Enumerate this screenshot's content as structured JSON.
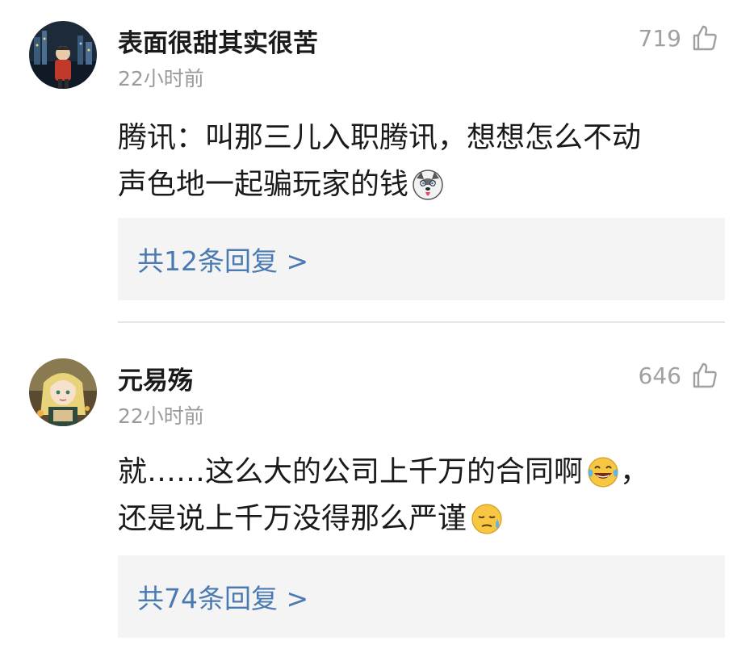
{
  "comments": [
    {
      "username": "表面很甜其实很苦",
      "time": "22小时前",
      "likes": "719",
      "text_line1": "腾讯：叫那三儿入职腾讯，想想怎么不动",
      "text_line2": "声色地一起骗玩家的钱",
      "emoji": "husky-tongue-emoji",
      "replies_label": "共12条回复 >"
    },
    {
      "username": "元易殇",
      "time": "22小时前",
      "likes": "646",
      "text_line1": "就……这么大的公司上千万的合同啊",
      "text_line1_suffix": "，",
      "text_line2": "还是说上千万没得那么严谨",
      "emoji1": "laughing-tears-emoji",
      "emoji2": "cold-sweat-emoji",
      "replies_label": "共74条回复 >"
    }
  ],
  "colors": {
    "username": "#1a1a1a",
    "meta": "#9b9b9b",
    "link": "#4a7ab2",
    "reply_bg": "#f4f4f4",
    "divider": "#e6e6e6"
  }
}
